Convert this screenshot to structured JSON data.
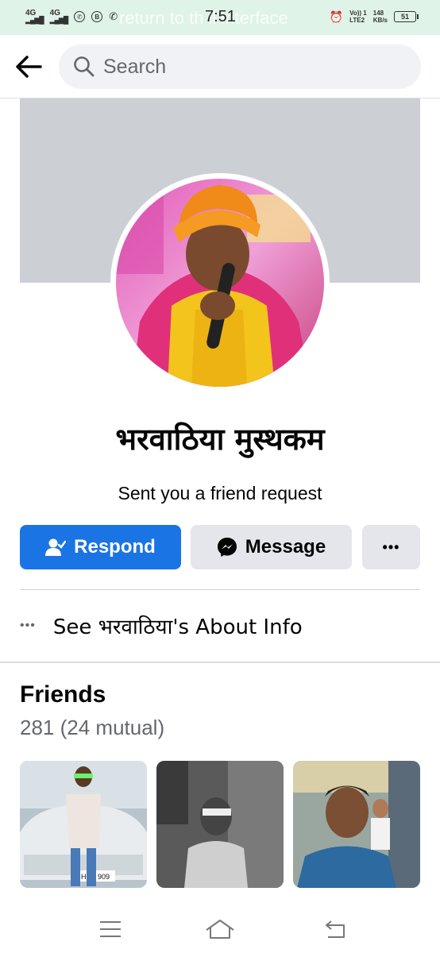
{
  "status_bar": {
    "left_indicators": [
      "4G",
      "4G"
    ],
    "ghost_text": "return to th   ll interface",
    "time": "7:51",
    "net_top": "Vo)) 1",
    "net_bottom": "LTE2",
    "speed_top": "148",
    "speed_bottom": "KB/s",
    "battery": "51"
  },
  "header": {
    "search_placeholder": "Search"
  },
  "profile": {
    "name": "भरवाठिया मुस्थकम",
    "subtitle": "Sent you a friend request"
  },
  "actions": {
    "respond_label": "Respond",
    "message_label": "Message",
    "more_label": "•••"
  },
  "about": {
    "label": "See भरवाठिया's About Info"
  },
  "friends": {
    "title": "Friends",
    "count": "281 (24 mutual)",
    "plate_text": "HO3   909"
  },
  "colors": {
    "primary": "#1b74e4",
    "secondary_button": "#e4e6eb",
    "cover": "#ccd0d5",
    "status_bar": "#dff3e8"
  }
}
